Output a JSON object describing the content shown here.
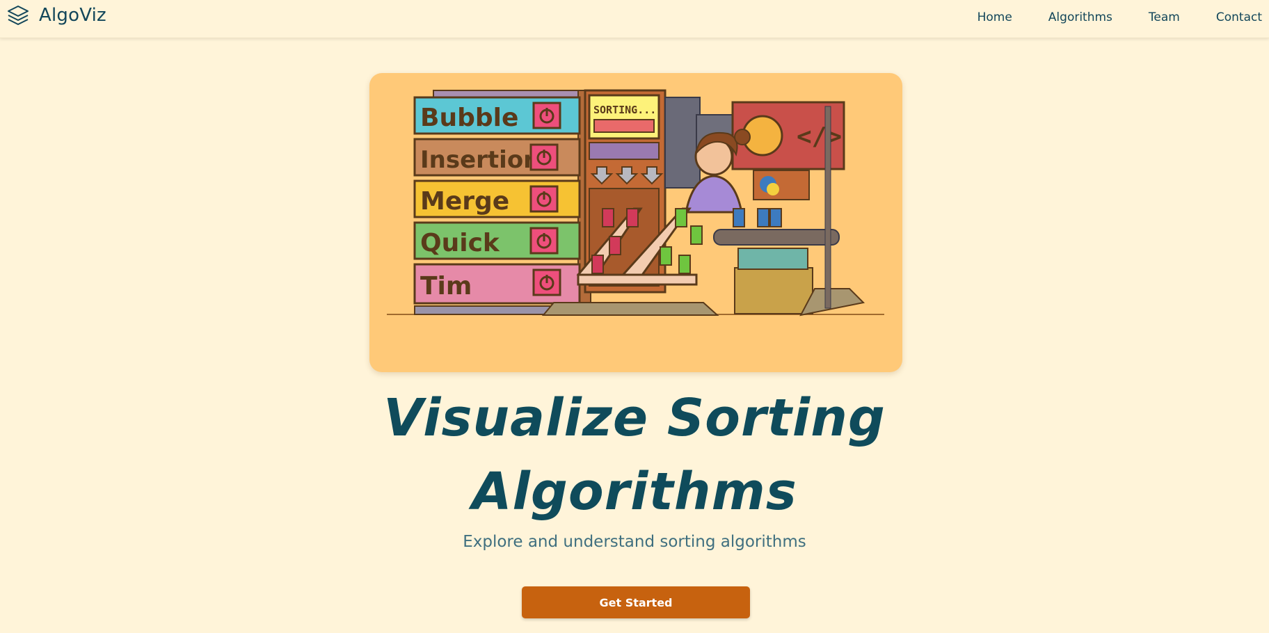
{
  "brand": {
    "name": "AlgoViz",
    "icon": "layers-icon"
  },
  "nav": {
    "items": [
      {
        "label": "Home"
      },
      {
        "label": "Algorithms"
      },
      {
        "label": "Team"
      },
      {
        "label": "Contact"
      }
    ]
  },
  "hero": {
    "illustration": {
      "shelf_labels": [
        "Bubble",
        "Insertion",
        "Merge",
        "Quick",
        "Tim"
      ],
      "screen_text": "SORTING...",
      "code_sign": "</>",
      "colors": {
        "card_background": "#ffc978",
        "bubble": "#5cc7d4",
        "insertion": "#c98a5c",
        "merge": "#f6c233",
        "quick": "#7cc36b",
        "tim": "#e68aa8",
        "power_button": "#ee4f7c"
      }
    },
    "title_line1": "Visualize Sorting",
    "title_line2": "Algorithms",
    "subtitle": "Explore and understand sorting algorithms",
    "cta_label": "Get Started"
  },
  "theme": {
    "page_background": "#fff4d9",
    "primary_text": "#0f4b5b",
    "accent": "#c7620f"
  }
}
